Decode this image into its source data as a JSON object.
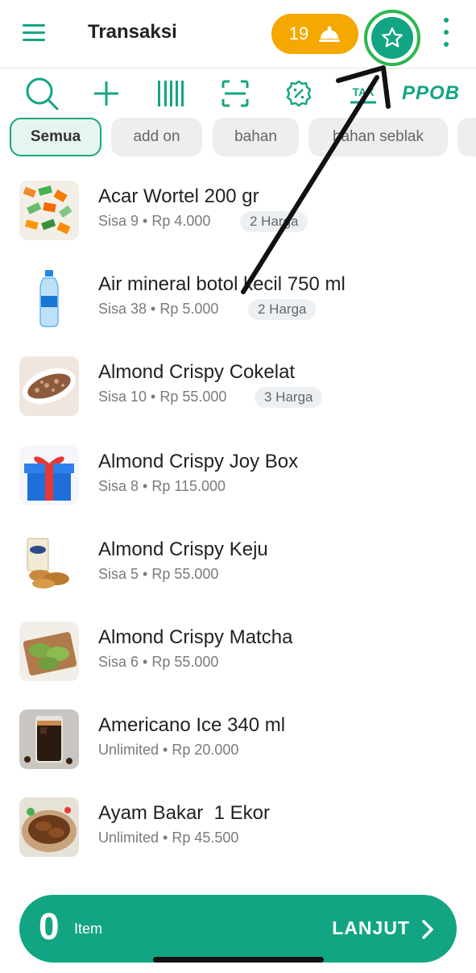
{
  "header": {
    "title": "Transaksi",
    "orders_count": "19",
    "icons": {
      "menu": "hamburger-icon",
      "orders": "cloche-icon",
      "favorite": "star-icon",
      "more": "kebab-icon"
    }
  },
  "toolbar": {
    "tax_label": "TAX",
    "ppob_label": "PPOB"
  },
  "categories": [
    "Semua",
    "add on",
    "bahan",
    "bahan seblak"
  ],
  "products": [
    {
      "name": "Acar Wortel 200 gr",
      "meta": "Sisa 9 • Rp 4.000",
      "harga": "2 Harga"
    },
    {
      "name": "Air mineral botol kecil 750 ml",
      "meta": "Sisa 38 • Rp 5.000",
      "harga": "2 Harga"
    },
    {
      "name": "Almond Crispy Cokelat",
      "meta": "Sisa 10 • Rp 55.000",
      "harga": "3 Harga"
    },
    {
      "name": "Almond Crispy Joy Box",
      "meta": "Sisa 8 • Rp 115.000",
      "harga": ""
    },
    {
      "name": "Almond Crispy Keju",
      "meta": "Sisa 5 • Rp 55.000",
      "harga": ""
    },
    {
      "name": "Almond Crispy Matcha",
      "meta": "Sisa 6 • Rp 55.000",
      "harga": ""
    },
    {
      "name": "Americano Ice 340 ml",
      "meta": "Unlimited • Rp 20.000",
      "harga": ""
    },
    {
      "name": "Ayam Bakar  1 Ekor",
      "meta": "Unlimited • Rp 45.500",
      "harga": ""
    }
  ],
  "cart": {
    "count": "0",
    "count_label": "Item",
    "continue_label": "LANJUT"
  },
  "colors": {
    "brand": "#12a583",
    "badge": "#f5a800",
    "highlight_ring": "#2db84e"
  }
}
